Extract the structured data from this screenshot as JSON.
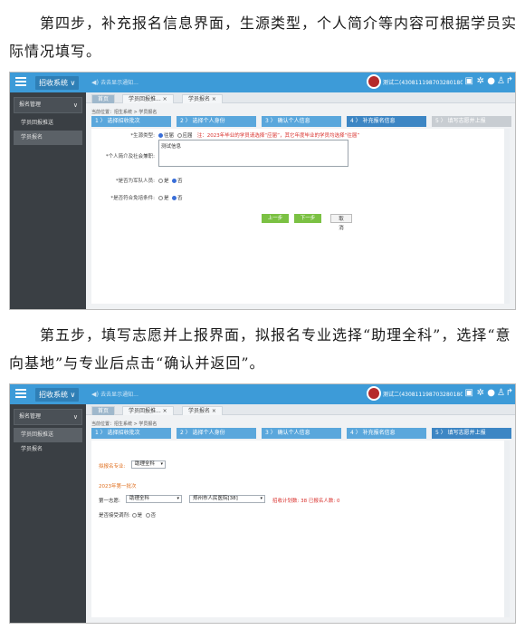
{
  "doc": {
    "para1": "第四步，补充报名信息界面，生源类型，个人简介等内容可根据学员实际情况填写。",
    "para2": "第五步，填写志愿并上报界面，拟报名专业选择“助理全科”，选择“意向基地”与专业后点击“确认并返回”。"
  },
  "colors": {
    "topbar": "#3d9bd8",
    "sidebar": "#3a3f44",
    "step_done": "#5aa7dc",
    "step_current": "#3d86c4",
    "step_todo": "#c8cdd2",
    "green_button": "#7bc143",
    "warning": "#d9302c"
  },
  "app": {
    "system_menu": "招收系统 ∨",
    "notice": "去去显示通知...",
    "notice_icon": "speaker-icon",
    "user": "测试二(430811198703280180)",
    "icons": [
      "message-icon",
      "gear-icon",
      "help-icon",
      "person-icon",
      "exit-icon"
    ],
    "side_section": "报名管理",
    "breadcrumb": "当前位置：招生系统 > 学员报名"
  },
  "shot1": {
    "side_items": [
      "学员回报推送",
      "学员报名"
    ],
    "tabs": [
      "首页",
      "学员回报推... ×",
      "学员报名 ×"
    ],
    "steps": [
      "1 〉 选择招收批次",
      "2 〉 选择个人身份",
      "3 〉 确认个人信息",
      "4 〉 补充报名信息",
      "5 〉 填写志愿并上报"
    ],
    "source_label": "*生源类型:",
    "source_opt1": "往届",
    "source_opt2": "应届",
    "source_warning": "注：2023年毕业的学员请选择“应届”，其它年度毕业的学员均选择“往届”",
    "intro_label": "*个人简介及社会兼职:",
    "intro_value": "测试信息",
    "q1_label": "*是否为军队人员:",
    "q2_label": "*是否符合免培条件:",
    "yes": "是",
    "no": "否",
    "btn_prev": "上一步",
    "btn_next": "下一步",
    "btn_cancel": "取消"
  },
  "shot2": {
    "side_items": [
      "学员回报推送",
      "学员报名"
    ],
    "tabs": [
      "首页",
      "学员回报推... ×",
      "学员报名 ×"
    ],
    "steps": [
      "1 〉 选择招收批次",
      "2 〉 选择个人身份",
      "3 〉 确认个人信息",
      "4 〉 补充报名信息",
      "5 〉 填写志愿并上报"
    ],
    "major_label": "拟报名专业:",
    "major_value": "助理全科",
    "batch_title": "2023年第一批次",
    "choice_label": "第一志愿:",
    "choice_major": "助理全科",
    "choice_base": "郑州市人民医院[38]",
    "plan_text": "招收计划数: 38  已报名人数: 0",
    "adjust_label": "是否接受调剂:",
    "yes": "是",
    "no": "否"
  }
}
